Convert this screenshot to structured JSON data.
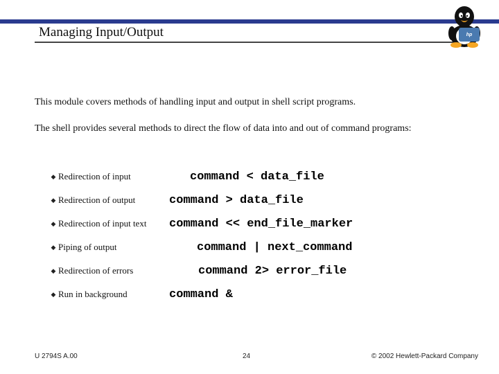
{
  "title": "Managing Input/Output",
  "intro1": "This module covers methods of handling input and output in shell script programs.",
  "intro2": "The shell provides several methods to direct the flow of data into and out of command programs:",
  "items": [
    {
      "label": "Redirection of input",
      "cmd": "command < data_file",
      "offset": "offset1"
    },
    {
      "label": "Redirection of output",
      "cmd": "command > data_file",
      "offset": "offset0"
    },
    {
      "label": "Redirection of input text",
      "cmd": "command << end_file_marker",
      "offset": "offset0"
    },
    {
      "label": "Piping of output",
      "cmd": "command | next_command",
      "offset": "offset2"
    },
    {
      "label": "Redirection of errors",
      "cmd": "command 2> error_file",
      "offset": "offset3"
    },
    {
      "label": "Run in background",
      "cmd": "command &",
      "offset": "offset0"
    }
  ],
  "footer": {
    "left": "U 2794S A.00",
    "center": "24",
    "right": "© 2002 Hewlett-Packard Company"
  },
  "hp": "hp"
}
